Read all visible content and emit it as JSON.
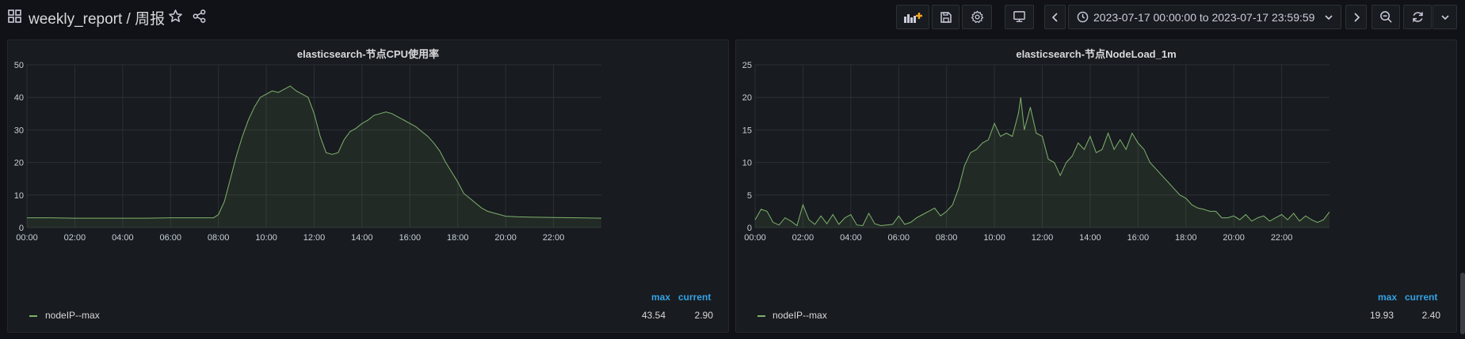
{
  "header": {
    "title": "weekly_report / 周报",
    "time_range": "2023-07-17 00:00:00 to 2023-07-17 23:59:59"
  },
  "icons": {
    "apps": "apps-icon",
    "star": "star-icon",
    "share": "share-icon",
    "add_panel": "add-panel-icon",
    "save": "save-icon",
    "settings": "gear-icon",
    "tv_mode": "monitor-icon",
    "prev": "chevron-left-icon",
    "clock": "clock-icon",
    "dropdown": "chevron-down-icon",
    "next": "chevron-right-icon",
    "zoom_out": "zoom-out-icon",
    "refresh": "refresh-icon",
    "refresh_dropdown": "chevron-down-icon"
  },
  "colors": {
    "series": "#7eb26d",
    "legend_header": "#33a2e5",
    "add_panel_accent": "#f5a623"
  },
  "panels": [
    {
      "title": "elasticsearch-节点CPU使用率",
      "legend": {
        "header_max": "max",
        "header_current": "current",
        "series_name": "nodeIP--max",
        "max": "43.54",
        "current": "2.90"
      }
    },
    {
      "title": "elasticsearch-节点NodeLoad_1m",
      "legend": {
        "header_max": "max",
        "header_current": "current",
        "series_name": "nodeIP--max",
        "max": "19.93",
        "current": "2.40"
      }
    }
  ],
  "chart_data": [
    {
      "type": "area",
      "title": "elasticsearch-节点CPU使用率",
      "xlabel": "",
      "ylabel": "",
      "x_ticks": [
        "00:00",
        "02:00",
        "04:00",
        "06:00",
        "08:00",
        "10:00",
        "12:00",
        "14:00",
        "16:00",
        "18:00",
        "20:00",
        "22:00"
      ],
      "y_ticks": [
        "0",
        "10",
        "20",
        "30",
        "40",
        "50"
      ],
      "xlim": [
        0,
        24
      ],
      "ylim": [
        0,
        50
      ],
      "grid": true,
      "legend_position": "bottom-left",
      "series": [
        {
          "name": "nodeIP--max",
          "x": [
            0,
            1,
            2,
            3,
            4,
            5,
            6,
            7,
            7.8,
            8,
            8.25,
            8.5,
            8.75,
            9,
            9.25,
            9.5,
            9.75,
            10,
            10.25,
            10.5,
            10.75,
            11,
            11.25,
            11.5,
            11.75,
            12,
            12.25,
            12.5,
            12.75,
            13,
            13.25,
            13.5,
            13.75,
            14,
            14.25,
            14.5,
            14.75,
            15,
            15.25,
            15.5,
            15.75,
            16,
            16.25,
            16.5,
            16.75,
            17,
            17.25,
            17.5,
            17.75,
            18,
            18.25,
            18.5,
            18.75,
            19,
            19.25,
            19.5,
            19.75,
            20,
            20.5,
            21,
            22,
            23,
            24
          ],
          "y": [
            3,
            3,
            2.9,
            2.9,
            2.9,
            2.9,
            3,
            3,
            3,
            4,
            8,
            15,
            22,
            28,
            33,
            37,
            40,
            41,
            42,
            41.5,
            42.5,
            43.5,
            42,
            41,
            40,
            35,
            28,
            23,
            22.5,
            23,
            27,
            29.5,
            30.5,
            32,
            33,
            34.5,
            35,
            35.5,
            35,
            34,
            33,
            32,
            31,
            29.5,
            28,
            26,
            23.5,
            20,
            17,
            14,
            10.5,
            9,
            7.5,
            6,
            5,
            4.5,
            4,
            3.5,
            3.3,
            3.2,
            3.1,
            3,
            2.9
          ]
        }
      ]
    },
    {
      "type": "area",
      "title": "elasticsearch-节点NodeLoad_1m",
      "xlabel": "",
      "ylabel": "",
      "x_ticks": [
        "00:00",
        "02:00",
        "04:00",
        "06:00",
        "08:00",
        "10:00",
        "12:00",
        "14:00",
        "16:00",
        "18:00",
        "20:00",
        "22:00"
      ],
      "y_ticks": [
        "0",
        "5",
        "10",
        "15",
        "20",
        "25"
      ],
      "xlim": [
        0,
        24
      ],
      "ylim": [
        0,
        25
      ],
      "grid": true,
      "legend_position": "bottom-left",
      "series": [
        {
          "name": "nodeIP--max",
          "x": [
            0,
            0.25,
            0.5,
            0.75,
            1,
            1.25,
            1.5,
            1.75,
            2,
            2.25,
            2.5,
            2.75,
            3,
            3.25,
            3.5,
            3.75,
            4,
            4.25,
            4.5,
            4.75,
            5,
            5.25,
            5.5,
            5.75,
            6,
            6.25,
            6.5,
            6.75,
            7,
            7.25,
            7.5,
            7.75,
            8,
            8.25,
            8.5,
            8.75,
            9,
            9.25,
            9.5,
            9.75,
            10,
            10.25,
            10.5,
            10.75,
            11,
            11.1,
            11.25,
            11.5,
            11.75,
            12,
            12.25,
            12.5,
            12.75,
            13,
            13.25,
            13.5,
            13.75,
            14,
            14.25,
            14.5,
            14.75,
            15,
            15.25,
            15.5,
            15.75,
            16,
            16.25,
            16.5,
            16.75,
            17,
            17.25,
            17.5,
            17.75,
            18,
            18.25,
            18.5,
            18.75,
            19,
            19.25,
            19.5,
            19.75,
            20,
            20.25,
            20.5,
            20.75,
            21,
            21.25,
            21.5,
            21.75,
            22,
            22.25,
            22.5,
            22.75,
            23,
            23.25,
            23.5,
            23.75,
            24
          ],
          "y": [
            1.2,
            2.8,
            2.5,
            0.8,
            0.4,
            1.5,
            1.0,
            0.3,
            3.5,
            1.2,
            0.5,
            1.8,
            0.6,
            2.0,
            0.5,
            1.5,
            2.0,
            0.4,
            0.3,
            2.2,
            0.6,
            0.3,
            0.4,
            0.5,
            1.8,
            0.5,
            0.8,
            1.5,
            2.0,
            2.5,
            3.0,
            1.8,
            2.5,
            3.5,
            6,
            9.5,
            11.5,
            12,
            13,
            13.5,
            16,
            14,
            14.5,
            14,
            17.5,
            20,
            15,
            18.5,
            14.5,
            14,
            10.5,
            10,
            8,
            10,
            11,
            13,
            12,
            14,
            11.5,
            12,
            14.5,
            12,
            13.5,
            12,
            14.5,
            13,
            12,
            10,
            9,
            8,
            7,
            6,
            5,
            4.5,
            3.5,
            3,
            2.8,
            2.5,
            2.5,
            1.5,
            1.5,
            1.8,
            1.2,
            2.0,
            1.0,
            1.5,
            1.8,
            1.0,
            1.5,
            2.0,
            1.2,
            2.2,
            1.0,
            1.8,
            1.2,
            0.8,
            1.2,
            2.4
          ]
        }
      ]
    }
  ]
}
